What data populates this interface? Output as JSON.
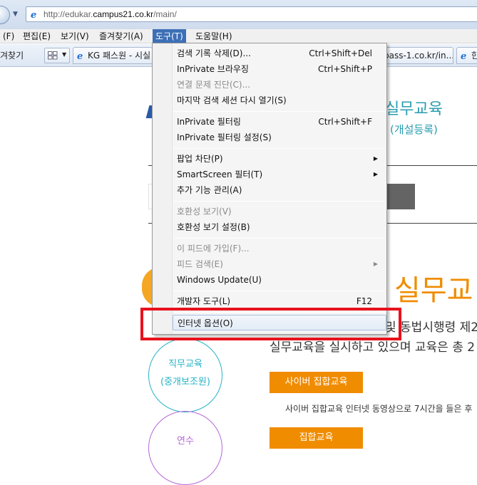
{
  "browser": {
    "url_prefix": "http://edukar.",
    "url_domain": "campus21.co.kr",
    "url_path": "/main/",
    "menu": [
      "(F)",
      "편집(E)",
      "보기(V)",
      "즐겨찾기(A)",
      "도구(T)",
      "도움말(H)"
    ],
    "favorites_label": "겨찾기",
    "tabs": [
      {
        "label": "KG 패스원 - 시실"
      },
      {
        "label": "pass-1.co.kr/in..."
      },
      {
        "label": "한"
      }
    ]
  },
  "tools_menu": {
    "items": [
      {
        "label": "검색 기록 삭제(D)...",
        "shortcut": "Ctrl+Shift+Del",
        "disabled": false
      },
      {
        "label": "InPrivate 브라우징",
        "shortcut": "Ctrl+Shift+P",
        "disabled": false
      },
      {
        "label": "연결 문제 진단(C)...",
        "shortcut": "",
        "disabled": true
      },
      {
        "label": "마지막 검색 세션 다시 열기(S)",
        "shortcut": "",
        "disabled": false
      },
      {
        "label": "InPrivate 필터링",
        "shortcut": "Ctrl+Shift+F",
        "disabled": false
      },
      {
        "label": "InPrivate 필터링 설정(S)",
        "shortcut": "",
        "disabled": false
      },
      {
        "label": "팝업 차단(P)",
        "shortcut": "",
        "disabled": false,
        "submenu": true
      },
      {
        "label": "SmartScreen 필터(T)",
        "shortcut": "",
        "disabled": false,
        "submenu": true
      },
      {
        "label": "추가 기능 관리(A)",
        "shortcut": "",
        "disabled": false
      },
      {
        "label": "호환성 보기(V)",
        "shortcut": "",
        "disabled": true
      },
      {
        "label": "호환성 보기 설정(B)",
        "shortcut": "",
        "disabled": false
      },
      {
        "label": "이 피드에 가입(F)...",
        "shortcut": "",
        "disabled": true
      },
      {
        "label": "피드 검색(E)",
        "shortcut": "",
        "disabled": true,
        "submenu": true
      },
      {
        "label": "Windows Update(U)",
        "shortcut": "",
        "disabled": false
      },
      {
        "label": "개발자 도구(L)",
        "shortcut": "F12",
        "disabled": false
      },
      {
        "label": "인터넷 옵션(O)",
        "shortcut": "",
        "disabled": false,
        "highlighted": true
      }
    ]
  },
  "page": {
    "heading_right": "실무교육",
    "heading_sub": "(개설등록)",
    "big_title": "실무교",
    "line1": "및 동법시행령 제2",
    "line2": "실무교육을 실시하고 있으며 교육은 총 2",
    "circle1_line1": "직무교육",
    "circle1_line2": "(중개보조원)",
    "circle2_text": "연수",
    "btn_cyber": "사이버 집합교육",
    "cyber_desc": "사이버 집합교육 인터넷 동영상으로 7시간을 들은 후",
    "btn_group": "집합교육"
  },
  "colors": {
    "accent_blue": "#3d6fb6",
    "orange": "#f08c00",
    "highlight_red": "#e8111c",
    "teal": "#26b3c6",
    "purple": "#b36ad8"
  }
}
